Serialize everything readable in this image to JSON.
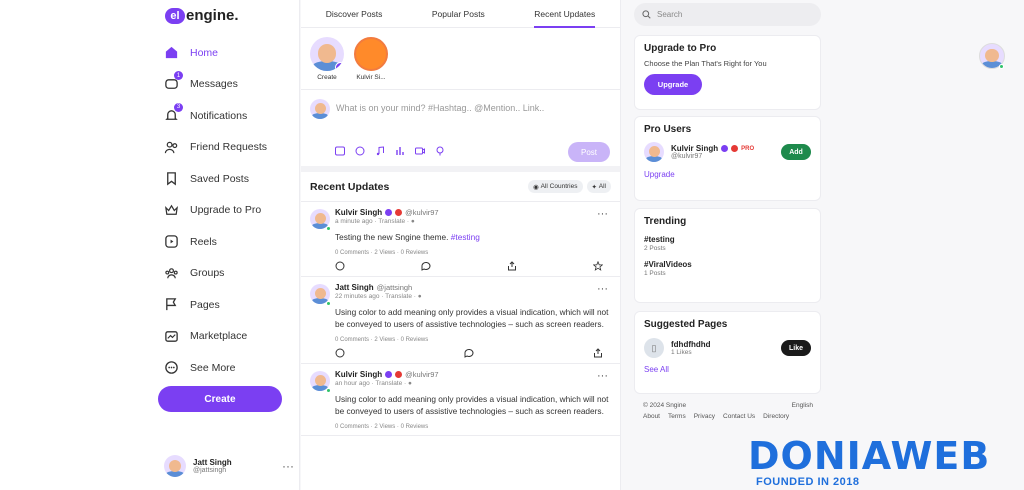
{
  "app": {
    "logo_mark": "el",
    "logo_text": "engine."
  },
  "sidebar": {
    "items": [
      {
        "label": "Home",
        "icon": "home-icon",
        "active": true
      },
      {
        "label": "Messages",
        "icon": "messages-icon",
        "badge": "1"
      },
      {
        "label": "Notifications",
        "icon": "bell-icon",
        "badge": "3"
      },
      {
        "label": "Friend Requests",
        "icon": "users-icon"
      },
      {
        "label": "Saved Posts",
        "icon": "bookmark-icon"
      },
      {
        "label": "Upgrade to Pro",
        "icon": "crown-icon"
      },
      {
        "label": "Reels",
        "icon": "reels-icon"
      },
      {
        "label": "Groups",
        "icon": "groups-icon"
      },
      {
        "label": "Pages",
        "icon": "flag-icon"
      },
      {
        "label": "Marketplace",
        "icon": "store-icon"
      },
      {
        "label": "See More",
        "icon": "more-icon"
      }
    ],
    "create_label": "Create",
    "user": {
      "name": "Jatt Singh",
      "handle": "@jattsingh",
      "menu": "···"
    }
  },
  "tabs": [
    {
      "label": "Discover Posts"
    },
    {
      "label": "Popular Posts"
    },
    {
      "label": "Recent Updates",
      "active": true
    }
  ],
  "stories": [
    {
      "label": "Create"
    },
    {
      "label": "Kulvir Si..."
    }
  ],
  "composer": {
    "placeholder": "What is on your mind? #Hashtag.. @Mention.. Link..",
    "post_label": "Post"
  },
  "feed": {
    "title": "Recent Updates",
    "filter_countries": "All Countries",
    "filter_all": "All",
    "posts": [
      {
        "author": "Kulvir Singh",
        "handle": "@kulvir97",
        "time": "a minute ago",
        "translate": "Translate",
        "text": "Testing the new Sngine theme.",
        "tag": "#testing",
        "stats": "0 Comments  ·  2 Views  ·  0 Reviews"
      },
      {
        "author": "Jatt Singh",
        "handle": "@jattsingh",
        "time": "22 minutes ago",
        "translate": "Translate",
        "text": "Using color to add meaning only provides a visual indication, which will not be conveyed to users of assistive technologies – such as screen readers.",
        "stats": "0 Comments  ·  2 Views  ·  0 Reviews"
      },
      {
        "author": "Kulvir Singh",
        "handle": "@kulvir97",
        "time": "an hour ago",
        "translate": "Translate",
        "text": "Using color to add meaning only provides a visual indication, which will not be conveyed to users of assistive technologies – such as screen readers.",
        "stats": "0 Comments  ·  2 Views  ·  0 Reviews"
      }
    ]
  },
  "right": {
    "search_placeholder": "Search",
    "upgrade": {
      "title": "Upgrade to Pro",
      "desc": "Choose the Plan That's Right for You",
      "button": "Upgrade"
    },
    "pro_users": {
      "title": "Pro Users",
      "user": {
        "name": "Kulvir Singh",
        "badge": "PRO",
        "handle": "@kulvir97"
      },
      "add_label": "Add",
      "link": "Upgrade"
    },
    "trending": {
      "title": "Trending",
      "items": [
        {
          "tag": "#testing",
          "count": "2 Posts"
        },
        {
          "tag": "#ViralVideos",
          "count": "1 Posts"
        }
      ]
    },
    "suggested_pages": {
      "title": "Suggested Pages",
      "page": {
        "name": "fdhdfhdhd",
        "likes": "1 Likes"
      },
      "like_label": "Like",
      "link": "See All"
    },
    "footer": {
      "copyright": "© 2024 Sngine",
      "language": "English",
      "links": [
        "About",
        "Terms",
        "Privacy",
        "Contact Us",
        "Directory"
      ]
    }
  },
  "watermark": {
    "text": "DONIAWEB",
    "sub": "FOUNDED IN 2018"
  },
  "colors": {
    "accent": "#7b3ff2",
    "add": "#1e8a4c",
    "brand": "#1f6fdc"
  }
}
